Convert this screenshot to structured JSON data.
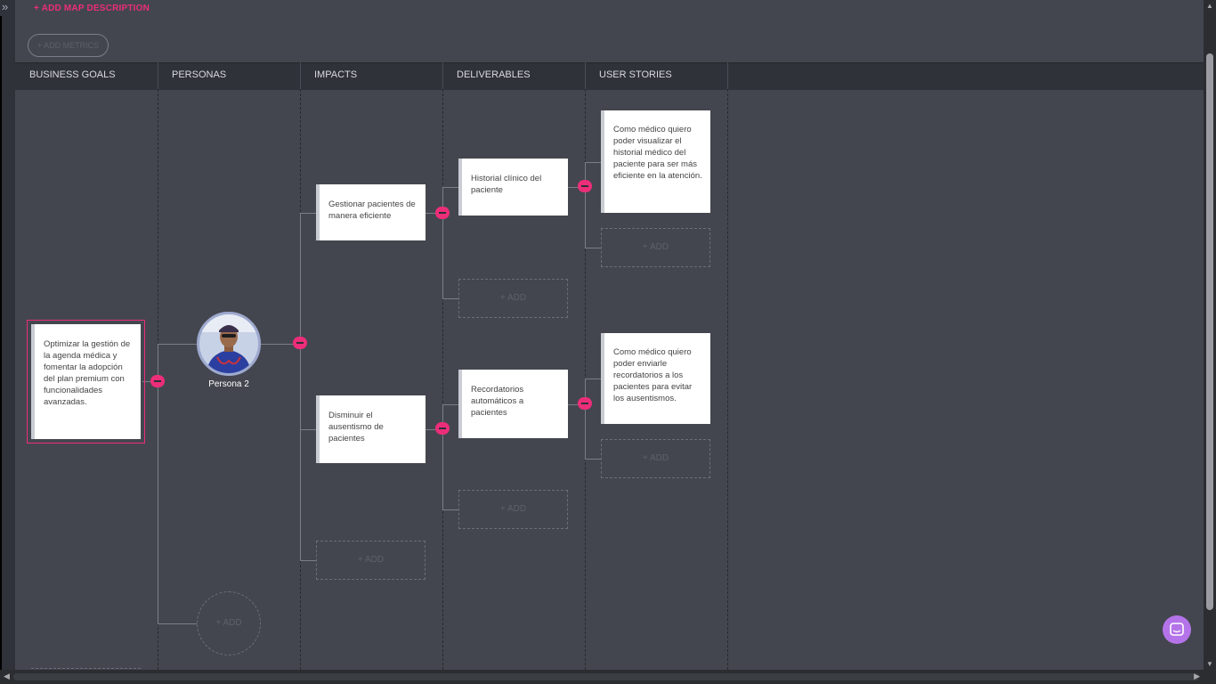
{
  "toolbar": {
    "add_map_description": "ADD MAP DESCRIPTION",
    "add_metrics": "+ ADD METRICS"
  },
  "columns": [
    "BUSINESS GOALS",
    "PERSONAS",
    "IMPACTS",
    "DELIVERABLES",
    "USER STORIES"
  ],
  "goal": {
    "text": "Optimizar la gestión de la agenda médica y fomentar la adopción del plan premium con funcionalidades avanzadas."
  },
  "persona": {
    "name": "Persona 2",
    "add_label": "+ ADD"
  },
  "impacts": [
    {
      "text": "Gestionar pacientes de manera  eficiente"
    },
    {
      "text": "Disminuir el ausentismo de pacientes"
    }
  ],
  "deliverables": [
    {
      "text": "Historial clínico del paciente"
    },
    {
      "text": "Recordatorios automáticos a pacientes"
    }
  ],
  "user_stories": [
    {
      "text": "Como médico quiero poder visualizar el historial médico del paciente para ser más eficiente en la atención."
    },
    {
      "text": "Como médico quiero poder enviarle recordatorios a los pacientes para evitar los ausentismos."
    }
  ],
  "add_label": "+ ADD",
  "colors": {
    "accent": "#ec2d7a",
    "background": "#43464e",
    "header": "#2f3238",
    "chat": "#b473e8"
  }
}
